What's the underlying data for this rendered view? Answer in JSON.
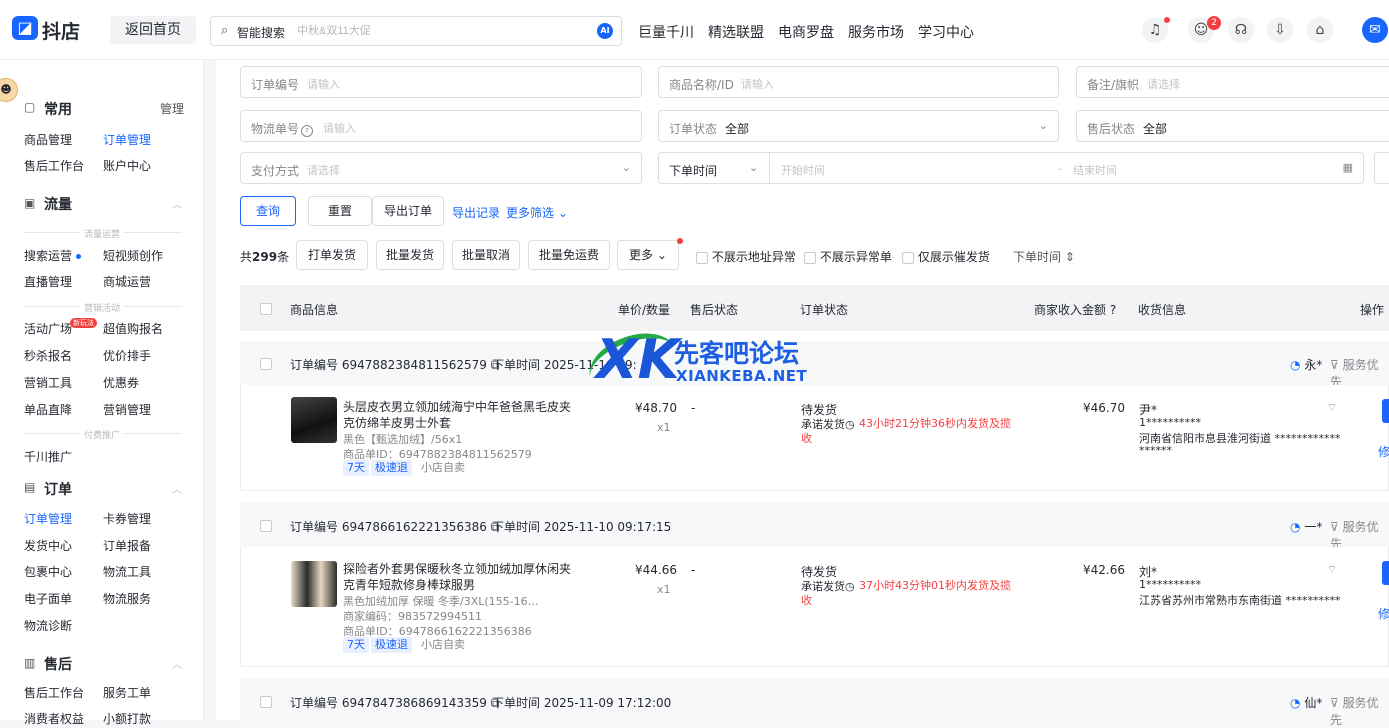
{
  "header": {
    "logo_text": "抖店",
    "home_button": "返回首页",
    "search_label": "智能搜索",
    "search_placeholder": "中秋&双11大促",
    "ai_badge": "AI",
    "nav": [
      "巨量千川",
      "精选联盟",
      "电商罗盘",
      "服务市场",
      "学习中心"
    ],
    "message_count": "2",
    "icons": [
      "bell-icon",
      "user-icon",
      "headset-icon",
      "download-icon",
      "store-icon",
      "chat-icon"
    ]
  },
  "sidebar": {
    "common": {
      "title": "常用",
      "manage": "管理",
      "items": [
        "商品管理",
        "订单管理",
        "售后工作台",
        "账户中心"
      ]
    },
    "traffic": {
      "title": "流量",
      "divider1": "流量运营",
      "items1": [
        "搜索运营",
        "短视频创作",
        "直播管理",
        "商城运营"
      ],
      "divider2": "营销活动",
      "items2": [
        "活动广场",
        "超值购报名",
        "秒杀报名",
        "优价排手",
        "营销工具",
        "优惠券",
        "单品直降",
        "营销管理"
      ],
      "new_tag": "新玩法",
      "divider3": "付费推广",
      "items3": [
        "千川推广"
      ]
    },
    "orders": {
      "title": "订单",
      "items": [
        "订单管理",
        "卡券管理",
        "发货中心",
        "订单报备",
        "包裹中心",
        "物流工具",
        "电子面单",
        "物流服务",
        "物流诊断"
      ]
    },
    "aftersales": {
      "title": "售后",
      "items": [
        "售后工作台",
        "服务工单",
        "消费者权益",
        "小额打款"
      ]
    }
  },
  "filters": {
    "order_no": {
      "label": "订单编号",
      "placeholder": "请输入"
    },
    "product": {
      "label": "商品名称/ID",
      "placeholder": "请输入"
    },
    "remark": {
      "label": "备注/旗帜",
      "placeholder": "请选择"
    },
    "tracking": {
      "label": "物流单号",
      "placeholder": "请输入"
    },
    "order_status": {
      "label": "订单状态",
      "value": "全部"
    },
    "after_status": {
      "label": "售后状态",
      "value": "全部"
    },
    "payment": {
      "label": "支付方式",
      "placeholder": "请选择"
    },
    "time": {
      "label": "下单时间",
      "start": "开始时间",
      "end": "结束时间",
      "sep": "–"
    }
  },
  "actions": {
    "query": "查询",
    "reset": "重置",
    "export": "导出订单",
    "export_log": "导出记录",
    "more_filter": "更多筛选"
  },
  "toolbar": {
    "count_prefix": "共",
    "count": "299",
    "count_suffix": "条",
    "buttons": [
      "打单发货",
      "批量发货",
      "批量取消",
      "批量免运费",
      "更多"
    ],
    "checks": [
      "不展示地址异常",
      "不展示异常单",
      "仅展示催发货"
    ],
    "sort": "下单时间"
  },
  "table": {
    "headers": [
      "商品信息",
      "单价/数量",
      "售后状态",
      "订单状态",
      "商家收入金额",
      "收货信息",
      "操作"
    ]
  },
  "orders": [
    {
      "order_no_label": "订单编号",
      "order_no": "6947882384811562579",
      "time_label": "下单时间",
      "time": "2025-11-10 09:",
      "buyer": "永*",
      "service": "服务优先",
      "title": "头层皮衣男立领加绒海宁中年爸爸黑毛皮夹克仿绵羊皮男士外套",
      "spec": "黑色【甄选加绒】/56x1",
      "product_id": "商品单ID：6947882384811562579",
      "tags": [
        "7天",
        "极速退",
        "小店自卖"
      ],
      "price": "¥48.70",
      "qty": "x1",
      "after": "-",
      "status": "待发货",
      "promise": "承诺发货",
      "countdown": "43小时21分钟36秒内发货及揽收",
      "income": "¥46.70",
      "recv_name": "尹*",
      "recv_phone": "1**********",
      "recv_addr": "河南省信阳市息县淮河街道 ************",
      "recv_addr2": "******",
      "action": "修"
    },
    {
      "order_no_label": "订单编号",
      "order_no": "6947866162221356386",
      "time_label": "下单时间",
      "time": "2025-11-10 09:17:15",
      "buyer": "一*",
      "service": "服务优先",
      "title": "探险者外套男保暖秋冬立领加绒加厚休闲夹克青年短款修身棒球服男",
      "spec": "黑色加绒加厚 保暖 冬季/3XL(155-16…",
      "merchant_code": "商家编码：983572994511",
      "product_id": "商品单ID：6947866162221356386",
      "tags": [
        "7天",
        "极速退",
        "小店自卖"
      ],
      "price": "¥44.66",
      "qty": "x1",
      "after": "-",
      "status": "待发货",
      "promise": "承诺发货",
      "countdown": "37小时43分钟01秒内发货及揽收",
      "income": "¥42.66",
      "recv_name": "刘*",
      "recv_phone": "1**********",
      "recv_addr": "江苏省苏州市常熟市东南街道 **********",
      "action": "修"
    },
    {
      "order_no_label": "订单编号",
      "order_no": "6947847386869143359",
      "time_label": "下单时间",
      "time": "2025-11-09 17:12:00",
      "buyer": "仙*",
      "service": "服务优先"
    }
  ],
  "watermark": {
    "logo": "XK",
    "cn": "先客吧论坛",
    "en": "XIANKEBA.NET"
  }
}
